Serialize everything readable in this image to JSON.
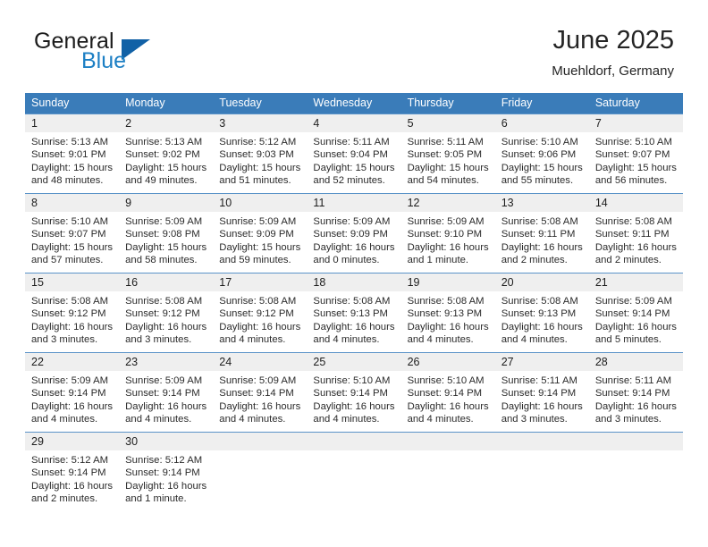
{
  "brand": {
    "word1": "General",
    "word2": "Blue",
    "triangle_icon": "blue-triangle-logo-icon",
    "accent_color": "#1161a6",
    "blue_text_color": "#1c7fc4"
  },
  "header": {
    "title": "June 2025",
    "subtitle": "Muehldorf, Germany"
  },
  "calendar": {
    "header_bg": "#3a7cb9",
    "daynum_bg": "#efefef",
    "separator_color": "#5a93c8",
    "weekdays": [
      "Sunday",
      "Monday",
      "Tuesday",
      "Wednesday",
      "Thursday",
      "Friday",
      "Saturday"
    ],
    "weeks": [
      {
        "days": [
          {
            "num": "1",
            "sunrise": "Sunrise: 5:13 AM",
            "sunset": "Sunset: 9:01 PM",
            "daylight1": "Daylight: 15 hours",
            "daylight2": "and 48 minutes."
          },
          {
            "num": "2",
            "sunrise": "Sunrise: 5:13 AM",
            "sunset": "Sunset: 9:02 PM",
            "daylight1": "Daylight: 15 hours",
            "daylight2": "and 49 minutes."
          },
          {
            "num": "3",
            "sunrise": "Sunrise: 5:12 AM",
            "sunset": "Sunset: 9:03 PM",
            "daylight1": "Daylight: 15 hours",
            "daylight2": "and 51 minutes."
          },
          {
            "num": "4",
            "sunrise": "Sunrise: 5:11 AM",
            "sunset": "Sunset: 9:04 PM",
            "daylight1": "Daylight: 15 hours",
            "daylight2": "and 52 minutes."
          },
          {
            "num": "5",
            "sunrise": "Sunrise: 5:11 AM",
            "sunset": "Sunset: 9:05 PM",
            "daylight1": "Daylight: 15 hours",
            "daylight2": "and 54 minutes."
          },
          {
            "num": "6",
            "sunrise": "Sunrise: 5:10 AM",
            "sunset": "Sunset: 9:06 PM",
            "daylight1": "Daylight: 15 hours",
            "daylight2": "and 55 minutes."
          },
          {
            "num": "7",
            "sunrise": "Sunrise: 5:10 AM",
            "sunset": "Sunset: 9:07 PM",
            "daylight1": "Daylight: 15 hours",
            "daylight2": "and 56 minutes."
          }
        ]
      },
      {
        "days": [
          {
            "num": "8",
            "sunrise": "Sunrise: 5:10 AM",
            "sunset": "Sunset: 9:07 PM",
            "daylight1": "Daylight: 15 hours",
            "daylight2": "and 57 minutes."
          },
          {
            "num": "9",
            "sunrise": "Sunrise: 5:09 AM",
            "sunset": "Sunset: 9:08 PM",
            "daylight1": "Daylight: 15 hours",
            "daylight2": "and 58 minutes."
          },
          {
            "num": "10",
            "sunrise": "Sunrise: 5:09 AM",
            "sunset": "Sunset: 9:09 PM",
            "daylight1": "Daylight: 15 hours",
            "daylight2": "and 59 minutes."
          },
          {
            "num": "11",
            "sunrise": "Sunrise: 5:09 AM",
            "sunset": "Sunset: 9:09 PM",
            "daylight1": "Daylight: 16 hours",
            "daylight2": "and 0 minutes."
          },
          {
            "num": "12",
            "sunrise": "Sunrise: 5:09 AM",
            "sunset": "Sunset: 9:10 PM",
            "daylight1": "Daylight: 16 hours",
            "daylight2": "and 1 minute."
          },
          {
            "num": "13",
            "sunrise": "Sunrise: 5:08 AM",
            "sunset": "Sunset: 9:11 PM",
            "daylight1": "Daylight: 16 hours",
            "daylight2": "and 2 minutes."
          },
          {
            "num": "14",
            "sunrise": "Sunrise: 5:08 AM",
            "sunset": "Sunset: 9:11 PM",
            "daylight1": "Daylight: 16 hours",
            "daylight2": "and 2 minutes."
          }
        ]
      },
      {
        "days": [
          {
            "num": "15",
            "sunrise": "Sunrise: 5:08 AM",
            "sunset": "Sunset: 9:12 PM",
            "daylight1": "Daylight: 16 hours",
            "daylight2": "and 3 minutes."
          },
          {
            "num": "16",
            "sunrise": "Sunrise: 5:08 AM",
            "sunset": "Sunset: 9:12 PM",
            "daylight1": "Daylight: 16 hours",
            "daylight2": "and 3 minutes."
          },
          {
            "num": "17",
            "sunrise": "Sunrise: 5:08 AM",
            "sunset": "Sunset: 9:12 PM",
            "daylight1": "Daylight: 16 hours",
            "daylight2": "and 4 minutes."
          },
          {
            "num": "18",
            "sunrise": "Sunrise: 5:08 AM",
            "sunset": "Sunset: 9:13 PM",
            "daylight1": "Daylight: 16 hours",
            "daylight2": "and 4 minutes."
          },
          {
            "num": "19",
            "sunrise": "Sunrise: 5:08 AM",
            "sunset": "Sunset: 9:13 PM",
            "daylight1": "Daylight: 16 hours",
            "daylight2": "and 4 minutes."
          },
          {
            "num": "20",
            "sunrise": "Sunrise: 5:08 AM",
            "sunset": "Sunset: 9:13 PM",
            "daylight1": "Daylight: 16 hours",
            "daylight2": "and 4 minutes."
          },
          {
            "num": "21",
            "sunrise": "Sunrise: 5:09 AM",
            "sunset": "Sunset: 9:14 PM",
            "daylight1": "Daylight: 16 hours",
            "daylight2": "and 5 minutes."
          }
        ]
      },
      {
        "days": [
          {
            "num": "22",
            "sunrise": "Sunrise: 5:09 AM",
            "sunset": "Sunset: 9:14 PM",
            "daylight1": "Daylight: 16 hours",
            "daylight2": "and 4 minutes."
          },
          {
            "num": "23",
            "sunrise": "Sunrise: 5:09 AM",
            "sunset": "Sunset: 9:14 PM",
            "daylight1": "Daylight: 16 hours",
            "daylight2": "and 4 minutes."
          },
          {
            "num": "24",
            "sunrise": "Sunrise: 5:09 AM",
            "sunset": "Sunset: 9:14 PM",
            "daylight1": "Daylight: 16 hours",
            "daylight2": "and 4 minutes."
          },
          {
            "num": "25",
            "sunrise": "Sunrise: 5:10 AM",
            "sunset": "Sunset: 9:14 PM",
            "daylight1": "Daylight: 16 hours",
            "daylight2": "and 4 minutes."
          },
          {
            "num": "26",
            "sunrise": "Sunrise: 5:10 AM",
            "sunset": "Sunset: 9:14 PM",
            "daylight1": "Daylight: 16 hours",
            "daylight2": "and 4 minutes."
          },
          {
            "num": "27",
            "sunrise": "Sunrise: 5:11 AM",
            "sunset": "Sunset: 9:14 PM",
            "daylight1": "Daylight: 16 hours",
            "daylight2": "and 3 minutes."
          },
          {
            "num": "28",
            "sunrise": "Sunrise: 5:11 AM",
            "sunset": "Sunset: 9:14 PM",
            "daylight1": "Daylight: 16 hours",
            "daylight2": "and 3 minutes."
          }
        ]
      },
      {
        "days": [
          {
            "num": "29",
            "sunrise": "Sunrise: 5:12 AM",
            "sunset": "Sunset: 9:14 PM",
            "daylight1": "Daylight: 16 hours",
            "daylight2": "and 2 minutes."
          },
          {
            "num": "30",
            "sunrise": "Sunrise: 5:12 AM",
            "sunset": "Sunset: 9:14 PM",
            "daylight1": "Daylight: 16 hours",
            "daylight2": "and 1 minute."
          },
          {
            "num": "",
            "sunrise": "",
            "sunset": "",
            "daylight1": "",
            "daylight2": ""
          },
          {
            "num": "",
            "sunrise": "",
            "sunset": "",
            "daylight1": "",
            "daylight2": ""
          },
          {
            "num": "",
            "sunrise": "",
            "sunset": "",
            "daylight1": "",
            "daylight2": ""
          },
          {
            "num": "",
            "sunrise": "",
            "sunset": "",
            "daylight1": "",
            "daylight2": ""
          },
          {
            "num": "",
            "sunrise": "",
            "sunset": "",
            "daylight1": "",
            "daylight2": ""
          }
        ]
      }
    ]
  }
}
